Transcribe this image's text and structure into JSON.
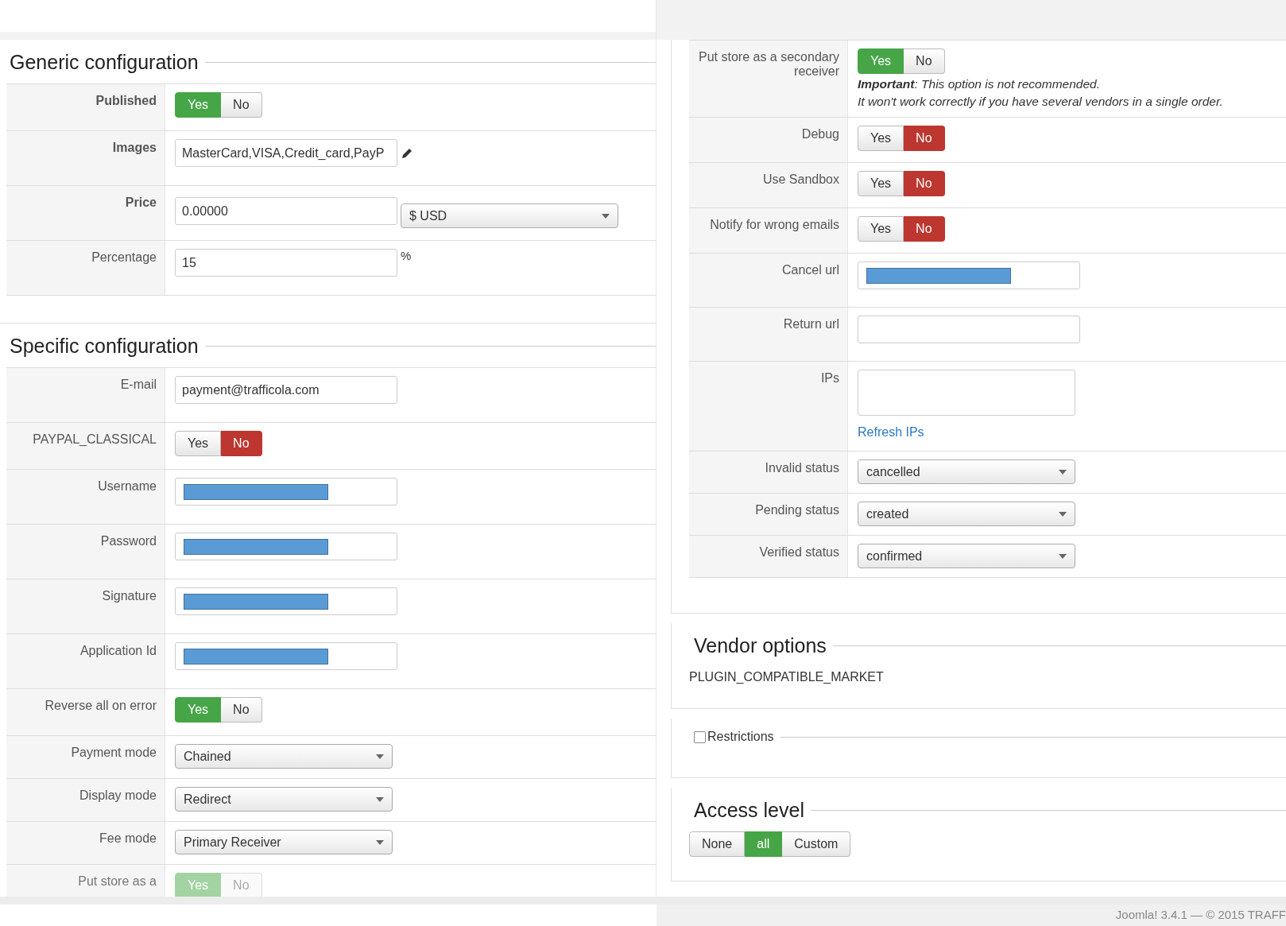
{
  "generic": {
    "title": "Generic configuration",
    "rows": [
      {
        "label": "Published",
        "bold": true,
        "kind": "toggle",
        "options": [
          {
            "label": "Yes",
            "color": "#46a546",
            "selected": true
          },
          {
            "label": "No",
            "selected": false
          }
        ]
      },
      {
        "label": "Images",
        "bold": true,
        "kind": "images",
        "value": "MasterCard,VISA,Credit_card,PayP"
      },
      {
        "label": "Price",
        "bold": true,
        "kind": "price",
        "value": "0.00000",
        "select": "$ USD"
      },
      {
        "label": "Percentage",
        "bold": false,
        "kind": "text",
        "value": "15",
        "suffix": "%"
      }
    ]
  },
  "specific": {
    "title": "Specific configuration",
    "rows": [
      {
        "label": "E-mail",
        "kind": "text",
        "value": "payment@trafficola.com"
      },
      {
        "label": "PAYPAL_CLASSICAL",
        "kind": "toggle",
        "options": [
          {
            "label": "Yes",
            "selected": false
          },
          {
            "label": "No",
            "color": "#bd362f",
            "selected": true
          }
        ]
      },
      {
        "label": "Username",
        "kind": "redacted"
      },
      {
        "label": "Password",
        "kind": "redacted"
      },
      {
        "label": "Signature",
        "kind": "redacted"
      },
      {
        "label": "Application Id",
        "kind": "redacted"
      },
      {
        "label": "Reverse all on error",
        "kind": "toggle",
        "options": [
          {
            "label": "Yes",
            "color": "#46a546",
            "selected": true
          },
          {
            "label": "No",
            "selected": false
          }
        ]
      },
      {
        "label": "Payment mode",
        "kind": "select",
        "value": "Chained"
      },
      {
        "label": "Display mode",
        "kind": "select",
        "value": "Redirect"
      },
      {
        "label": "Fee mode",
        "kind": "select",
        "value": "Primary Receiver"
      },
      {
        "label": "Put store as a",
        "kind": "toggle",
        "options": [
          {
            "label": "Yes",
            "color": "#a3d3a3",
            "selected": true
          },
          {
            "label": "No",
            "selected": false
          }
        ]
      }
    ]
  },
  "right": {
    "rows": [
      {
        "label": "Put store as a secondary receiver",
        "kind": "toggle",
        "options": [
          {
            "label": "Yes",
            "color": "#46a546",
            "selected": true
          },
          {
            "label": "No",
            "selected": false
          }
        ],
        "note": [
          "**Important**: This option is not recommended.",
          "It won't work correctly if you have several vendors in a single order."
        ]
      },
      {
        "label": "Debug",
        "kind": "toggle",
        "options": [
          {
            "label": "Yes",
            "selected": false
          },
          {
            "label": "No",
            "color": "#bd362f",
            "selected": true
          }
        ]
      },
      {
        "label": "Use Sandbox",
        "kind": "toggle",
        "options": [
          {
            "label": "Yes",
            "selected": false
          },
          {
            "label": "No",
            "color": "#bd362f",
            "selected": true
          }
        ]
      },
      {
        "label": "Notify for wrong emails",
        "kind": "toggle",
        "options": [
          {
            "label": "Yes",
            "selected": false
          },
          {
            "label": "No",
            "color": "#bd362f",
            "selected": true
          }
        ]
      },
      {
        "label": "Cancel url",
        "kind": "redacted"
      },
      {
        "label": "Return url",
        "kind": "empty"
      },
      {
        "label": "IPs",
        "kind": "textarea",
        "link": "Refresh IPs"
      },
      {
        "label": "Invalid status",
        "kind": "select",
        "value": "cancelled"
      },
      {
        "label": "Pending status",
        "kind": "select",
        "value": "created"
      },
      {
        "label": "Verified status",
        "kind": "select",
        "value": "confirmed"
      }
    ]
  },
  "vendor": {
    "title": "Vendor options",
    "text": "PLUGIN_COMPATIBLE_MARKET"
  },
  "restrictions": {
    "label": "Restrictions",
    "checked": false
  },
  "access": {
    "title": "Access level",
    "options": [
      {
        "label": "None",
        "selected": false
      },
      {
        "label": "all",
        "color": "#46a546",
        "selected": true
      },
      {
        "label": "Custom",
        "selected": false
      }
    ]
  },
  "footer": "Joomla! 3.4.1 — © 2015 TRAFF"
}
